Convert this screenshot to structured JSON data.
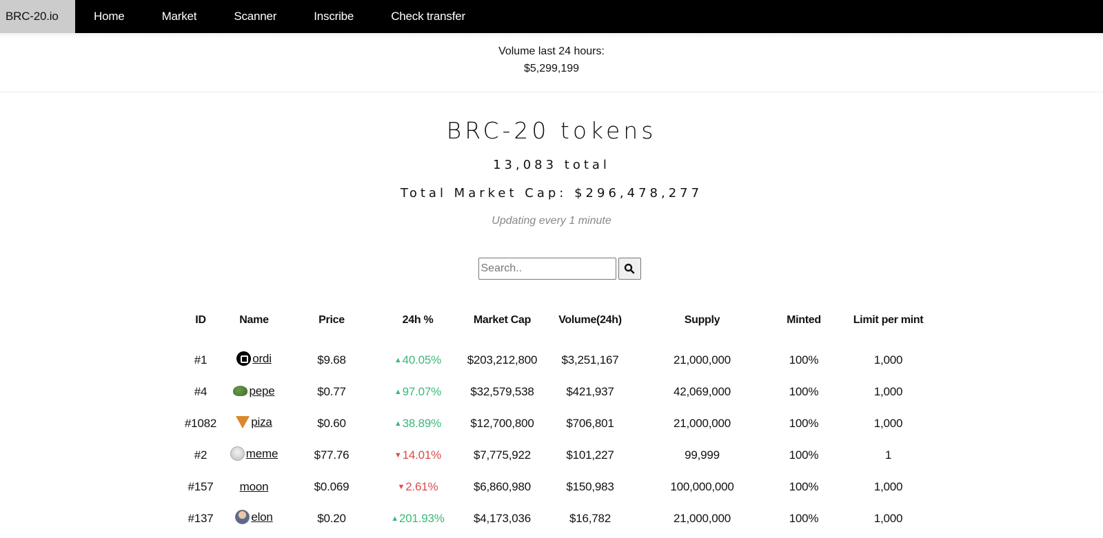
{
  "nav": {
    "brand": "BRC-20.io",
    "items": [
      "Home",
      "Market",
      "Scanner",
      "Inscribe",
      "Check transfer"
    ]
  },
  "volume": {
    "label": "Volume last 24 hours:",
    "value": "$5,299,199"
  },
  "hero": {
    "title": "BRC-20 tokens",
    "total": "13,083 total",
    "market_cap": "Total Market Cap: $296,478,277",
    "updating": "Updating every 1 minute"
  },
  "search": {
    "placeholder": "Search..",
    "value": "",
    "button_icon": "search-icon"
  },
  "colors": {
    "positive": "#3cb878",
    "negative": "#dd4a4a",
    "nav_bg": "#000000",
    "brand_bg": "#cccccc"
  },
  "table": {
    "columns": [
      "ID",
      "Name",
      "Price",
      "24h %",
      "Market Cap",
      "Volume(24h)",
      "Supply",
      "Minted",
      "Limit per mint"
    ],
    "rows": [
      {
        "id": "#1",
        "name": "ordi",
        "icon": "ordi",
        "price": "$9.68",
        "change": "40.05%",
        "direction": "up",
        "market_cap": "$203,212,800",
        "volume": "$3,251,167",
        "supply": "21,000,000",
        "minted": "100%",
        "limit": "1,000"
      },
      {
        "id": "#4",
        "name": "pepe",
        "icon": "pepe",
        "price": "$0.77",
        "change": "97.07%",
        "direction": "up",
        "market_cap": "$32,579,538",
        "volume": "$421,937",
        "supply": "42,069,000",
        "minted": "100%",
        "limit": "1,000"
      },
      {
        "id": "#1082",
        "name": "piza",
        "icon": "piza",
        "price": "$0.60",
        "change": "38.89%",
        "direction": "up",
        "market_cap": "$12,700,800",
        "volume": "$706,801",
        "supply": "21,000,000",
        "minted": "100%",
        "limit": "1,000"
      },
      {
        "id": "#2",
        "name": "meme",
        "icon": "meme",
        "price": "$77.76",
        "change": "14.01%",
        "direction": "down",
        "market_cap": "$7,775,922",
        "volume": "$101,227",
        "supply": "99,999",
        "minted": "100%",
        "limit": "1"
      },
      {
        "id": "#157",
        "name": "moon",
        "icon": "",
        "price": "$0.069",
        "change": "2.61%",
        "direction": "down",
        "market_cap": "$6,860,980",
        "volume": "$150,983",
        "supply": "100,000,000",
        "minted": "100%",
        "limit": "1,000"
      },
      {
        "id": "#137",
        "name": "elon",
        "icon": "elon",
        "price": "$0.20",
        "change": "201.93%",
        "direction": "up",
        "market_cap": "$4,173,036",
        "volume": "$16,782",
        "supply": "21,000,000",
        "minted": "100%",
        "limit": "1,000"
      }
    ]
  }
}
